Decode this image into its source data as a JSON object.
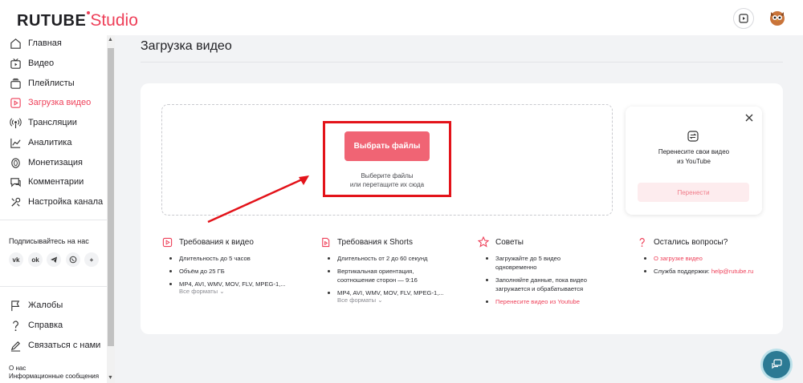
{
  "header": {
    "logo_main": "RUTUBE",
    "logo_studio": "Studio"
  },
  "sidebar": {
    "items": [
      {
        "label": "Главная",
        "icon": "home-icon"
      },
      {
        "label": "Видео",
        "icon": "video-icon"
      },
      {
        "label": "Плейлисты",
        "icon": "playlist-icon"
      },
      {
        "label": "Загрузка видео",
        "icon": "upload-video-icon",
        "active": true
      },
      {
        "label": "Трансляции",
        "icon": "broadcast-icon"
      },
      {
        "label": "Аналитика",
        "icon": "analytics-icon"
      },
      {
        "label": "Монетизация",
        "icon": "coin-icon"
      },
      {
        "label": "Комментарии",
        "icon": "comments-icon"
      },
      {
        "label": "Настройка канала",
        "icon": "settings-icon"
      }
    ],
    "subscribe_title": "Подписывайтесь на нас",
    "socials": [
      "VK",
      "OK",
      "Telegram",
      "Viber",
      "+"
    ],
    "bottom_items": [
      {
        "label": "Жалобы",
        "icon": "flag-icon"
      },
      {
        "label": "Справка",
        "icon": "question-icon"
      },
      {
        "label": "Связаться с нами",
        "icon": "edit-icon"
      }
    ],
    "about": [
      "О нас",
      "Информационные сообщения"
    ]
  },
  "main": {
    "title": "Загрузка видео",
    "choose_button": "Выбрать файлы",
    "hint_line1": "Выберите файлы",
    "hint_line2": "или перетащите их сюда",
    "transfer": {
      "line1": "Перенесите свои видео",
      "line2": "из YouTube",
      "button": "Перенести"
    },
    "columns": [
      {
        "title": "Требования к видео",
        "items": [
          "Длительность до 5 часов",
          "Объём до 25 ГБ",
          "MP4, AVI, WMV, MOV, FLV, MPEG-1,..."
        ],
        "formats": "Все форматы"
      },
      {
        "title": "Требования к Shorts",
        "items": [
          "Длительность от 2 до 60 секунд",
          "Вертикальная ориентация,",
          "соотношение сторон — 9:16",
          "MP4, AVI, WMV, MOV, FLV, MPEG-1,..."
        ],
        "formats": "Все форматы"
      },
      {
        "title": "Советы",
        "items": [
          "Загружайте до 5 видео",
          "одновременно",
          "Заполняйте данные, пока видео",
          "загружается и обрабатывается",
          "Перенесите видео из Youtube"
        ]
      },
      {
        "title": "Остались вопросы?",
        "items": [
          "О загрузке видео",
          "Служба поддержки:",
          "help@rutube.ru"
        ]
      }
    ]
  },
  "colors": {
    "accent": "#ee3f58",
    "button": "#f06474",
    "highlight": "#e3131a",
    "fab": "#2c7a94"
  }
}
